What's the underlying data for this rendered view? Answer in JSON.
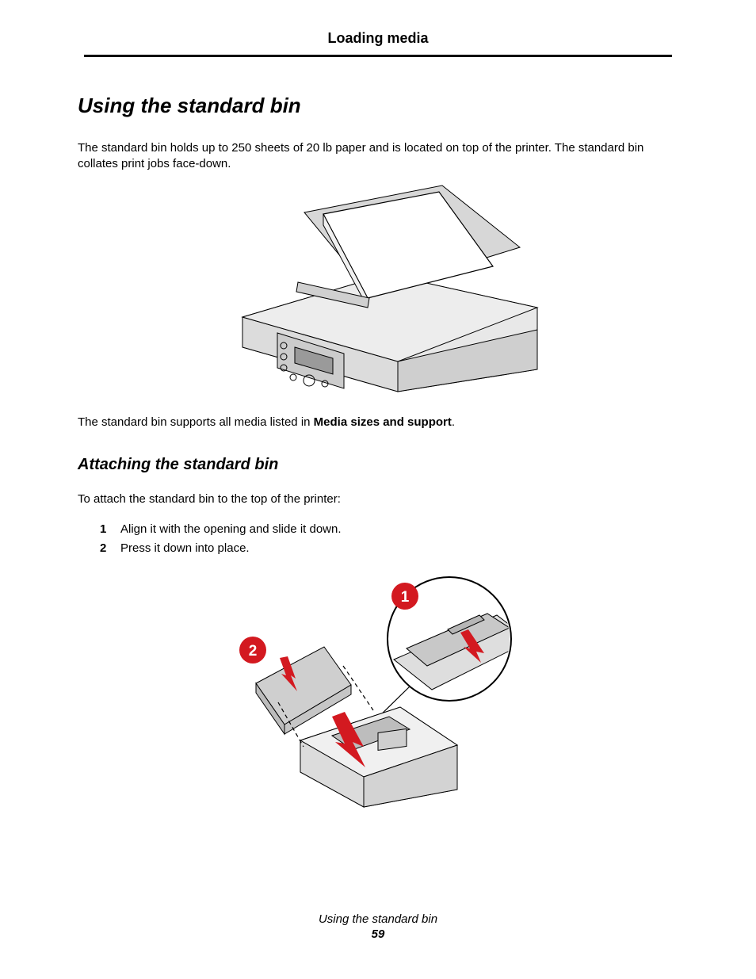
{
  "header": {
    "title": "Loading media"
  },
  "section": {
    "title": "Using the standard bin",
    "intro": "The standard bin holds up to 250 sheets of 20 lb paper and is located on top of the printer. The standard bin collates print jobs face-down.",
    "supports_prefix": "The standard bin supports all media listed in ",
    "supports_link": "Media sizes and support",
    "supports_suffix": "."
  },
  "subsection": {
    "title": "Attaching the standard bin",
    "lead": "To attach the standard bin to the top of the printer:",
    "steps": [
      {
        "num": "1",
        "text": "Align it with the opening and slide it down."
      },
      {
        "num": "2",
        "text": "Press it down into place."
      }
    ]
  },
  "figure2": {
    "callouts": {
      "one": "1",
      "two": "2"
    }
  },
  "footer": {
    "section": "Using the standard bin",
    "page": "59"
  }
}
